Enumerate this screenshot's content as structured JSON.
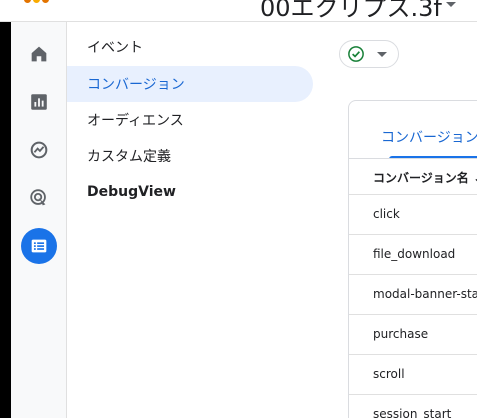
{
  "header": {
    "property_title": "00エクリプス.3f",
    "logo_icon": "analytics-logo-icon"
  },
  "rail": {
    "items": [
      {
        "icon": "home-icon"
      },
      {
        "icon": "reports-icon"
      },
      {
        "icon": "explore-icon"
      },
      {
        "icon": "advertising-icon"
      },
      {
        "icon": "admin-list-icon",
        "active": true
      }
    ]
  },
  "admin_nav": {
    "items": [
      {
        "label": "イベント"
      },
      {
        "label": "コンバージョン",
        "selected": true
      },
      {
        "label": "オーディエンス"
      },
      {
        "label": "カスタム定義"
      },
      {
        "label": "DebugView"
      }
    ]
  },
  "status_chip": {
    "icon": "check-circle-icon",
    "color": "#188038"
  },
  "main": {
    "tab_label": "コンバージョン",
    "column_header": "コンバージョン名 ↓",
    "rows": [
      "click",
      "file_download",
      "modal-banner-stack",
      "purchase",
      "scroll",
      "session_start"
    ]
  },
  "colors": {
    "accent": "#1a73e8",
    "selected_bg": "#e8f0fe",
    "selected_text": "#1967d2"
  }
}
